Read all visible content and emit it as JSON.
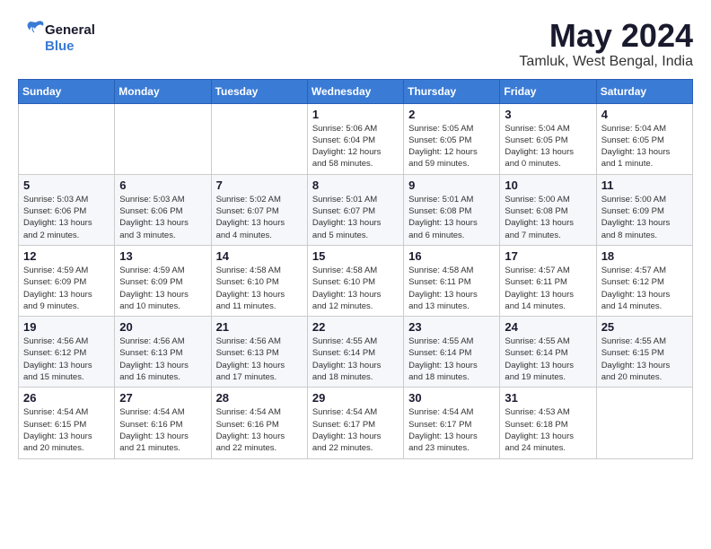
{
  "header": {
    "logo_line1": "General",
    "logo_line2": "Blue",
    "month": "May 2024",
    "location": "Tamluk, West Bengal, India"
  },
  "weekdays": [
    "Sunday",
    "Monday",
    "Tuesday",
    "Wednesday",
    "Thursday",
    "Friday",
    "Saturday"
  ],
  "weeks": [
    [
      {
        "day": "",
        "info": ""
      },
      {
        "day": "",
        "info": ""
      },
      {
        "day": "",
        "info": ""
      },
      {
        "day": "1",
        "info": "Sunrise: 5:06 AM\nSunset: 6:04 PM\nDaylight: 12 hours\nand 58 minutes."
      },
      {
        "day": "2",
        "info": "Sunrise: 5:05 AM\nSunset: 6:05 PM\nDaylight: 12 hours\nand 59 minutes."
      },
      {
        "day": "3",
        "info": "Sunrise: 5:04 AM\nSunset: 6:05 PM\nDaylight: 13 hours\nand 0 minutes."
      },
      {
        "day": "4",
        "info": "Sunrise: 5:04 AM\nSunset: 6:05 PM\nDaylight: 13 hours\nand 1 minute."
      }
    ],
    [
      {
        "day": "5",
        "info": "Sunrise: 5:03 AM\nSunset: 6:06 PM\nDaylight: 13 hours\nand 2 minutes."
      },
      {
        "day": "6",
        "info": "Sunrise: 5:03 AM\nSunset: 6:06 PM\nDaylight: 13 hours\nand 3 minutes."
      },
      {
        "day": "7",
        "info": "Sunrise: 5:02 AM\nSunset: 6:07 PM\nDaylight: 13 hours\nand 4 minutes."
      },
      {
        "day": "8",
        "info": "Sunrise: 5:01 AM\nSunset: 6:07 PM\nDaylight: 13 hours\nand 5 minutes."
      },
      {
        "day": "9",
        "info": "Sunrise: 5:01 AM\nSunset: 6:08 PM\nDaylight: 13 hours\nand 6 minutes."
      },
      {
        "day": "10",
        "info": "Sunrise: 5:00 AM\nSunset: 6:08 PM\nDaylight: 13 hours\nand 7 minutes."
      },
      {
        "day": "11",
        "info": "Sunrise: 5:00 AM\nSunset: 6:09 PM\nDaylight: 13 hours\nand 8 minutes."
      }
    ],
    [
      {
        "day": "12",
        "info": "Sunrise: 4:59 AM\nSunset: 6:09 PM\nDaylight: 13 hours\nand 9 minutes."
      },
      {
        "day": "13",
        "info": "Sunrise: 4:59 AM\nSunset: 6:09 PM\nDaylight: 13 hours\nand 10 minutes."
      },
      {
        "day": "14",
        "info": "Sunrise: 4:58 AM\nSunset: 6:10 PM\nDaylight: 13 hours\nand 11 minutes."
      },
      {
        "day": "15",
        "info": "Sunrise: 4:58 AM\nSunset: 6:10 PM\nDaylight: 13 hours\nand 12 minutes."
      },
      {
        "day": "16",
        "info": "Sunrise: 4:58 AM\nSunset: 6:11 PM\nDaylight: 13 hours\nand 13 minutes."
      },
      {
        "day": "17",
        "info": "Sunrise: 4:57 AM\nSunset: 6:11 PM\nDaylight: 13 hours\nand 14 minutes."
      },
      {
        "day": "18",
        "info": "Sunrise: 4:57 AM\nSunset: 6:12 PM\nDaylight: 13 hours\nand 14 minutes."
      }
    ],
    [
      {
        "day": "19",
        "info": "Sunrise: 4:56 AM\nSunset: 6:12 PM\nDaylight: 13 hours\nand 15 minutes."
      },
      {
        "day": "20",
        "info": "Sunrise: 4:56 AM\nSunset: 6:13 PM\nDaylight: 13 hours\nand 16 minutes."
      },
      {
        "day": "21",
        "info": "Sunrise: 4:56 AM\nSunset: 6:13 PM\nDaylight: 13 hours\nand 17 minutes."
      },
      {
        "day": "22",
        "info": "Sunrise: 4:55 AM\nSunset: 6:14 PM\nDaylight: 13 hours\nand 18 minutes."
      },
      {
        "day": "23",
        "info": "Sunrise: 4:55 AM\nSunset: 6:14 PM\nDaylight: 13 hours\nand 18 minutes."
      },
      {
        "day": "24",
        "info": "Sunrise: 4:55 AM\nSunset: 6:14 PM\nDaylight: 13 hours\nand 19 minutes."
      },
      {
        "day": "25",
        "info": "Sunrise: 4:55 AM\nSunset: 6:15 PM\nDaylight: 13 hours\nand 20 minutes."
      }
    ],
    [
      {
        "day": "26",
        "info": "Sunrise: 4:54 AM\nSunset: 6:15 PM\nDaylight: 13 hours\nand 20 minutes."
      },
      {
        "day": "27",
        "info": "Sunrise: 4:54 AM\nSunset: 6:16 PM\nDaylight: 13 hours\nand 21 minutes."
      },
      {
        "day": "28",
        "info": "Sunrise: 4:54 AM\nSunset: 6:16 PM\nDaylight: 13 hours\nand 22 minutes."
      },
      {
        "day": "29",
        "info": "Sunrise: 4:54 AM\nSunset: 6:17 PM\nDaylight: 13 hours\nand 22 minutes."
      },
      {
        "day": "30",
        "info": "Sunrise: 4:54 AM\nSunset: 6:17 PM\nDaylight: 13 hours\nand 23 minutes."
      },
      {
        "day": "31",
        "info": "Sunrise: 4:53 AM\nSunset: 6:18 PM\nDaylight: 13 hours\nand 24 minutes."
      },
      {
        "day": "",
        "info": ""
      }
    ]
  ]
}
